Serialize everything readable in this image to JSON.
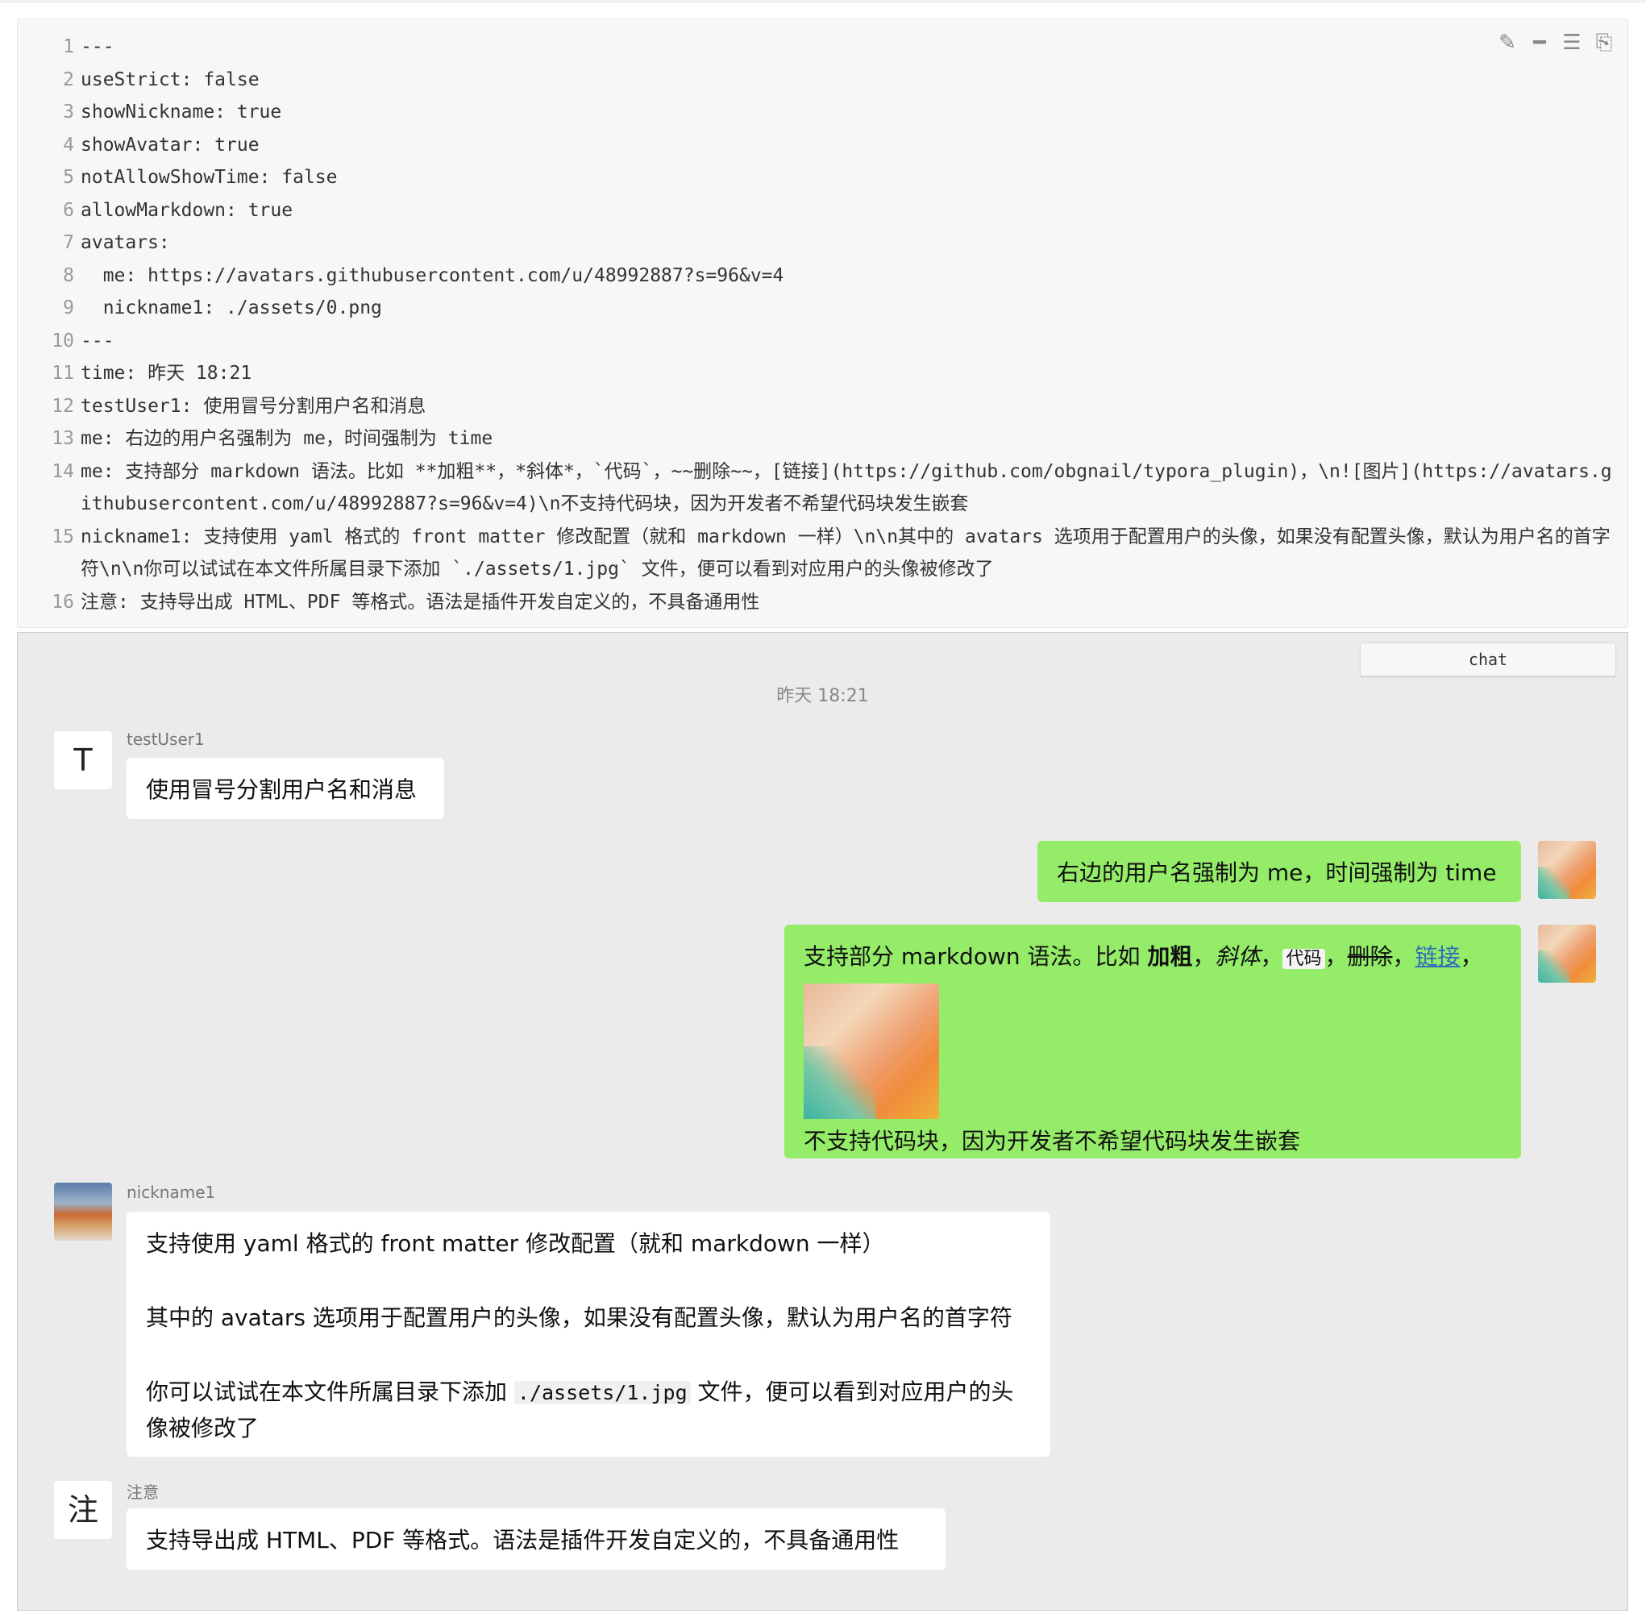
{
  "code": {
    "lines": [
      {
        "n": "1",
        "text": "---"
      },
      {
        "n": "2",
        "text": "useStrict: false"
      },
      {
        "n": "3",
        "text": "showNickname: true"
      },
      {
        "n": "4",
        "text": "showAvatar: true"
      },
      {
        "n": "5",
        "text": "notAllowShowTime: false"
      },
      {
        "n": "6",
        "text": "allowMarkdown: true"
      },
      {
        "n": "7",
        "text": "avatars:"
      },
      {
        "n": "8",
        "text": "  me: https://avatars.githubusercontent.com/u/48992887?s=96&v=4"
      },
      {
        "n": "9",
        "text": "  nickname1: ./assets/0.png"
      },
      {
        "n": "10",
        "text": "---"
      },
      {
        "n": "11",
        "text": "time: 昨天 18:21"
      },
      {
        "n": "12",
        "text": "testUser1: 使用冒号分割用户名和消息"
      },
      {
        "n": "13",
        "text": "me: 右边的用户名强制为 me，时间强制为 time"
      },
      {
        "n": "14",
        "text": "me: 支持部分 markdown 语法。比如 **加粗**，*斜体*，`代码`，~~删除~~，[链接](https://github.com/obgnail/typora_plugin)，\\n![图片](https://avatars.githubusercontent.com/u/48992887?s=96&v=4)\\n不支持代码块，因为开发者不希望代码块发生嵌套"
      },
      {
        "n": "15",
        "text": "nickname1: 支持使用 yaml 格式的 front matter 修改配置（就和 markdown 一样）\\n\\n其中的 avatars 选项用于配置用户的头像，如果没有配置头像，默认为用户名的首字符\\n\\n你可以试试在本文件所属目录下添加 `./assets/1.jpg` 文件，便可以看到对应用户的头像被修改了"
      },
      {
        "n": "16",
        "text": "注意: 支持导出成 HTML、PDF 等格式。语法是插件开发自定义的，不具备通用性"
      }
    ],
    "toolbar_icons": [
      "edit-icon",
      "minus-icon",
      "indent-icon",
      "copy-icon"
    ]
  },
  "chat": {
    "button_label": "chat",
    "time": "昨天 18:21",
    "messages": [
      {
        "user": "testUser1",
        "avatar_letter": "T",
        "text": "使用冒号分割用户名和消息"
      },
      {
        "user": "me",
        "text": "右边的用户名强制为 me，时间强制为 time"
      },
      {
        "user": "me",
        "md": {
          "prefix": "支持部分 markdown 语法。比如 ",
          "bold": "加粗",
          "sep1": "，",
          "italic": "斜体",
          "sep2": "，",
          "code": "代码",
          "sep3": "，",
          "del": "删除",
          "sep4": "，",
          "link": "链接",
          "sep5": "，",
          "suffix": "不支持代码块，因为开发者不希望代码块发生嵌套"
        }
      },
      {
        "user": "nickname1",
        "p1": "支持使用 yaml 格式的 front matter 修改配置（就和 markdown 一样）",
        "p2": "其中的 avatars 选项用于配置用户的头像，如果没有配置头像，默认为用户名的首字符",
        "p3_pre": "你可以试试在本文件所属目录下添加 ",
        "p3_code": "./assets/1.jpg",
        "p3_post": " 文件，便可以看到对应用户的头像被修改了"
      },
      {
        "user": "注意",
        "avatar_letter": "注",
        "text": "支持导出成 HTML、PDF 等格式。语法是插件开发自定义的，不具备通用性"
      }
    ]
  }
}
